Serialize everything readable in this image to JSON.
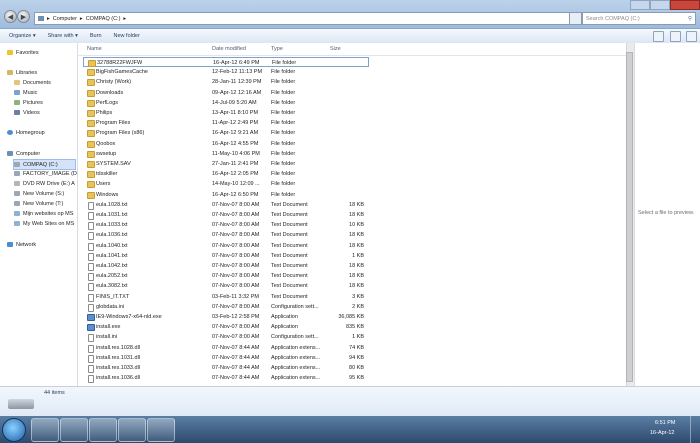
{
  "address": {
    "crumb1": "Computer",
    "sep": "▸",
    "crumb2": "COMPAQ (C:)",
    "search_placeholder": "Search COMPAQ (C:)"
  },
  "toolbar": {
    "organize": "Organize ▾",
    "share": "Share with ▾",
    "burn": "Burn",
    "new_folder": "New folder"
  },
  "nav": {
    "favorites": "Favorites",
    "libraries": "Libraries",
    "documents": "Documents",
    "music": "Music",
    "pictures": "Pictures",
    "videos": "Videos",
    "homegroup": "Homegroup",
    "computer": "Computer",
    "compaq": "COMPAQ (C:)",
    "factory": "FACTORY_IMAGE (D",
    "dvd": "DVD RW Drive (E:) A",
    "newvol_s": "New Volume (S:)",
    "newvol_t": "New Volume (T:)",
    "mijn": "Mijn websites op MS",
    "myweb": "My Web Sites on MS",
    "network": "Network"
  },
  "columns": {
    "name": "Name",
    "date": "Date modified",
    "type": "Type",
    "size": "Size"
  },
  "files": [
    {
      "name": "32788R22FWJFW",
      "date": "16-Apr-12 6:49 PM",
      "type": "File folder",
      "size": "",
      "kind": "folder"
    },
    {
      "name": "BigFishGamesCache",
      "date": "12-Feb-12 11:13 PM",
      "type": "File folder",
      "size": "",
      "kind": "folder"
    },
    {
      "name": "Christy (Work)",
      "date": "28-Jan-11 12:39 PM",
      "type": "File folder",
      "size": "",
      "kind": "folder"
    },
    {
      "name": "Downloads",
      "date": "09-Apr-12 12:16 AM",
      "type": "File folder",
      "size": "",
      "kind": "folder"
    },
    {
      "name": "PerfLogs",
      "date": "14-Jul-09 5:20 AM",
      "type": "File folder",
      "size": "",
      "kind": "folder"
    },
    {
      "name": "Philips",
      "date": "13-Apr-11 8:10 PM",
      "type": "File folder",
      "size": "",
      "kind": "folder"
    },
    {
      "name": "Program Files",
      "date": "11-Apr-12 2:49 PM",
      "type": "File folder",
      "size": "",
      "kind": "folder"
    },
    {
      "name": "Program Files (x86)",
      "date": "16-Apr-12 9:21 AM",
      "type": "File folder",
      "size": "",
      "kind": "folder"
    },
    {
      "name": "Qoobox",
      "date": "16-Apr-12 4:55 PM",
      "type": "File folder",
      "size": "",
      "kind": "folder"
    },
    {
      "name": "swsetup",
      "date": "11-May-10 4:06 PM",
      "type": "File folder",
      "size": "",
      "kind": "folder"
    },
    {
      "name": "SYSTEM.SAV",
      "date": "27-Jan-11 2:41 PM",
      "type": "File folder",
      "size": "",
      "kind": "folder"
    },
    {
      "name": "tdsskiller",
      "date": "16-Apr-12 2:05 PM",
      "type": "File folder",
      "size": "",
      "kind": "folder"
    },
    {
      "name": "Users",
      "date": "14-May-10 12:09 ...",
      "type": "File folder",
      "size": "",
      "kind": "folder"
    },
    {
      "name": "Windows",
      "date": "16-Apr-12 6:50 PM",
      "type": "File folder",
      "size": "",
      "kind": "folder"
    },
    {
      "name": "eula.1028.txt",
      "date": "07-Nov-07 8:00 AM",
      "type": "Text Document",
      "size": "18 KB",
      "kind": "doc"
    },
    {
      "name": "eula.1031.txt",
      "date": "07-Nov-07 8:00 AM",
      "type": "Text Document",
      "size": "18 KB",
      "kind": "doc"
    },
    {
      "name": "eula.1033.txt",
      "date": "07-Nov-07 8:00 AM",
      "type": "Text Document",
      "size": "10 KB",
      "kind": "doc"
    },
    {
      "name": "eula.1036.txt",
      "date": "07-Nov-07 8:00 AM",
      "type": "Text Document",
      "size": "18 KB",
      "kind": "doc"
    },
    {
      "name": "eula.1040.txt",
      "date": "07-Nov-07 8:00 AM",
      "type": "Text Document",
      "size": "18 KB",
      "kind": "doc"
    },
    {
      "name": "eula.1041.txt",
      "date": "07-Nov-07 8:00 AM",
      "type": "Text Document",
      "size": "1 KB",
      "kind": "doc"
    },
    {
      "name": "eula.1042.txt",
      "date": "07-Nov-07 8:00 AM",
      "type": "Text Document",
      "size": "18 KB",
      "kind": "doc"
    },
    {
      "name": "eula.2052.txt",
      "date": "07-Nov-07 8:00 AM",
      "type": "Text Document",
      "size": "18 KB",
      "kind": "doc"
    },
    {
      "name": "eula.3082.txt",
      "date": "07-Nov-07 8:00 AM",
      "type": "Text Document",
      "size": "18 KB",
      "kind": "doc"
    },
    {
      "name": "FINIS_IT.TXT",
      "date": "03-Feb-11 3:32 PM",
      "type": "Text Document",
      "size": "3 KB",
      "kind": "doc"
    },
    {
      "name": "globdata.ini",
      "date": "07-Nov-07 8:00 AM",
      "type": "Configuration sett...",
      "size": "2 KB",
      "kind": "doc"
    },
    {
      "name": "IE9-Windows7-x64-nld.exe",
      "date": "03-Feb-12 2:58 PM",
      "type": "Application",
      "size": "36,085 KB",
      "kind": "app"
    },
    {
      "name": "install.exe",
      "date": "07-Nov-07 8:00 AM",
      "type": "Application",
      "size": "835 KB",
      "kind": "app"
    },
    {
      "name": "install.ini",
      "date": "07-Nov-07 8:00 AM",
      "type": "Configuration sett...",
      "size": "1 KB",
      "kind": "doc"
    },
    {
      "name": "install.res.1028.dll",
      "date": "07-Nov-07 8:44 AM",
      "type": "Application extens...",
      "size": "74 KB",
      "kind": "doc"
    },
    {
      "name": "install.res.1031.dll",
      "date": "07-Nov-07 8:44 AM",
      "type": "Application extens...",
      "size": "94 KB",
      "kind": "doc"
    },
    {
      "name": "install.res.1033.dll",
      "date": "07-Nov-07 8:44 AM",
      "type": "Application extens...",
      "size": "80 KB",
      "kind": "doc"
    },
    {
      "name": "install.res.1036.dll",
      "date": "07-Nov-07 8:44 AM",
      "type": "Application extens...",
      "size": "95 KB",
      "kind": "doc"
    }
  ],
  "preview_text": "Select a file to preview.",
  "status": {
    "count": "44 items"
  },
  "clock": {
    "time": "6:51 PM",
    "date": "16-Apr-12"
  },
  "colors": {
    "accent": "#9fbcdd",
    "taskbar": "#2c4a6d",
    "folder": "#e8c25a"
  }
}
